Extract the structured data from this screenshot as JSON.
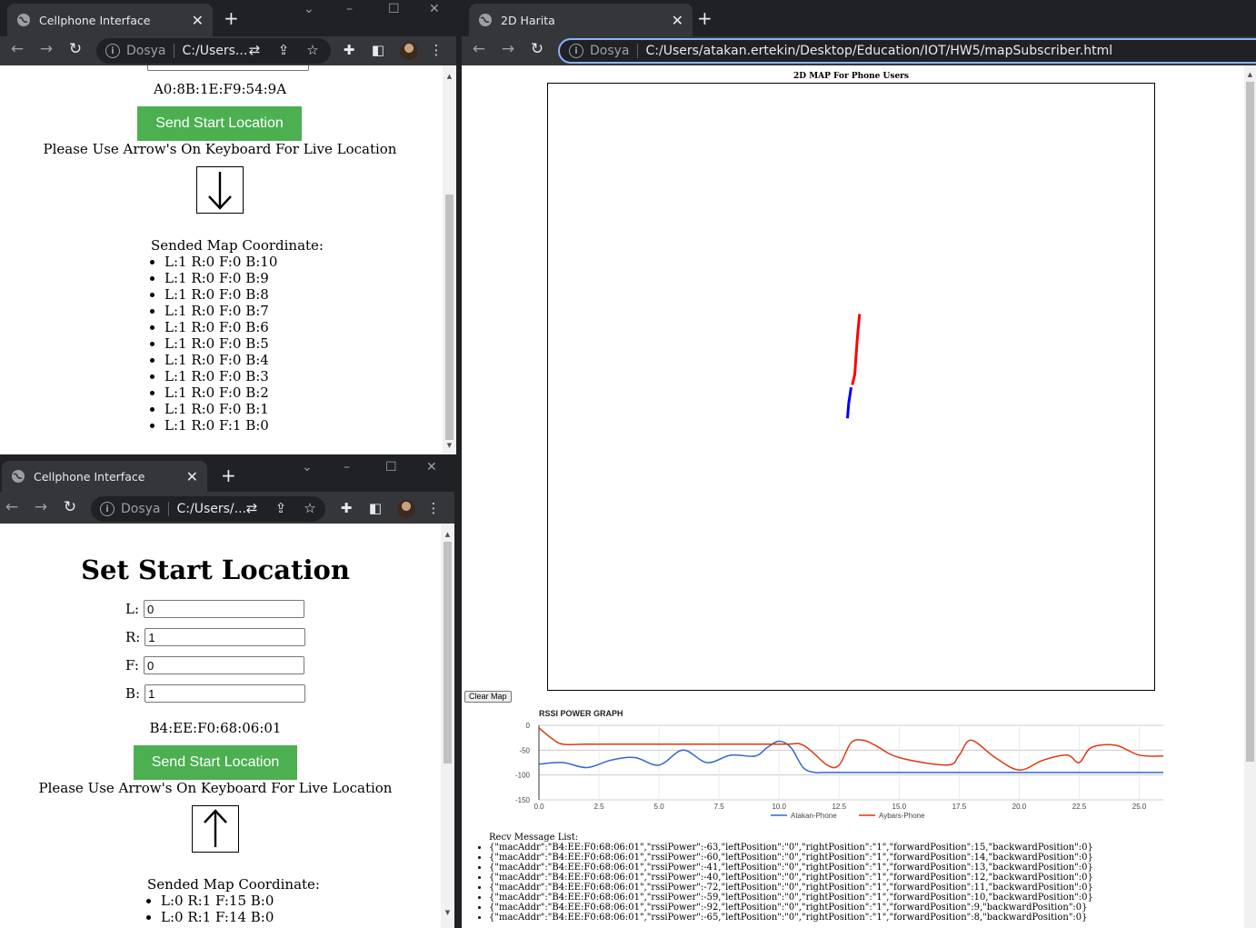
{
  "colors": {
    "accent_green": "#4CAF50",
    "chrome_dark": "#202124",
    "chrome_tab": "#35363a",
    "line_blue": "#0000ff",
    "line_red": "#ff0000",
    "rssi_blue": "#3366cc",
    "rssi_red": "#dc3912"
  },
  "top_left_window": {
    "tab_title": "Cellphone Interface",
    "security_label": "Dosya",
    "url": "C:/Users...",
    "mac": "A0:8B:1E:F9:54:9A",
    "send_button": "Send Start Location",
    "hint": "Please Use Arrow's On Keyboard For Live Location",
    "arrow_icon": "arrow-down-icon",
    "arrow_glyph": "↓",
    "coords_title": "Sended Map Coordinate:",
    "coords": [
      "L:1 R:0 F:0 B:10",
      "L:1 R:0 F:0 B:9",
      "L:1 R:0 F:0 B:8",
      "L:1 R:0 F:0 B:7",
      "L:1 R:0 F:0 B:6",
      "L:1 R:0 F:0 B:5",
      "L:1 R:0 F:0 B:4",
      "L:1 R:0 F:0 B:3",
      "L:1 R:0 F:0 B:2",
      "L:1 R:0 F:0 B:1",
      "L:1 R:0 F:1 B:0"
    ]
  },
  "bottom_left_window": {
    "tab_title": "Cellphone Interface",
    "security_label": "Dosya",
    "url": "C:/Users/...",
    "heading": "Set Start Location",
    "fields": [
      {
        "label": "L:",
        "value": "0"
      },
      {
        "label": "R:",
        "value": "1"
      },
      {
        "label": "F:",
        "value": "0"
      },
      {
        "label": "B:",
        "value": "1"
      }
    ],
    "mac": "B4:EE:F0:68:06:01",
    "send_button": "Send Start Location",
    "hint": "Please Use Arrow's On Keyboard For Live Location",
    "arrow_icon": "arrow-up-icon",
    "arrow_glyph": "↑",
    "coords_title": "Sended Map Coordinate:",
    "coords": [
      "L:0 R:1 F:15 B:0",
      "L:0 R:1 F:14 B:0"
    ]
  },
  "map_window": {
    "tab_title": "2D Harita",
    "security_label": "Dosya",
    "url": "C:/Users/atakan.ertekin/Desktop/Education/IOT/HW5/mapSubscriber.html",
    "map_title": "2D MAP For Phone Users",
    "clear_button": "Clear Map",
    "recv_title": "Recv Message List:",
    "messages": [
      "{\"macAddr\":\"B4:EE:F0:68:06:01\",\"rssiPower\":-63,\"leftPosition\":\"0\",\"rightPosition\":\"1\",\"forwardPosition\":15,\"backwardPosition\":0}",
      "{\"macAddr\":\"B4:EE:F0:68:06:01\",\"rssiPower\":-60,\"leftPosition\":\"0\",\"rightPosition\":\"1\",\"forwardPosition\":14,\"backwardPosition\":0}",
      "{\"macAddr\":\"B4:EE:F0:68:06:01\",\"rssiPower\":-41,\"leftPosition\":\"0\",\"rightPosition\":\"1\",\"forwardPosition\":13,\"backwardPosition\":0}",
      "{\"macAddr\":\"B4:EE:F0:68:06:01\",\"rssiPower\":-40,\"leftPosition\":\"0\",\"rightPosition\":\"1\",\"forwardPosition\":12,\"backwardPosition\":0}",
      "{\"macAddr\":\"B4:EE:F0:68:06:01\",\"rssiPower\":-72,\"leftPosition\":\"0\",\"rightPosition\":\"1\",\"forwardPosition\":11,\"backwardPosition\":0}",
      "{\"macAddr\":\"B4:EE:F0:68:06:01\",\"rssiPower\":-59,\"leftPosition\":\"0\",\"rightPosition\":\"1\",\"forwardPosition\":10,\"backwardPosition\":0}",
      "{\"macAddr\":\"B4:EE:F0:68:06:01\",\"rssiPower\":-92,\"leftPosition\":\"0\",\"rightPosition\":\"1\",\"forwardPosition\":9,\"backwardPosition\":0}",
      "{\"macAddr\":\"B4:EE:F0:68:06:01\",\"rssiPower\":-65,\"leftPosition\":\"0\",\"rightPosition\":\"1\",\"forwardPosition\":8,\"backwardPosition\":0}"
    ]
  },
  "chart_data": {
    "type": "line",
    "title": "RSSI POWER GRAPH",
    "xlabel": "",
    "ylabel": "",
    "xlim": [
      0,
      26
    ],
    "ylim": [
      -150,
      0
    ],
    "xticks": [
      "0.0",
      "2.5",
      "5.0",
      "7.5",
      "10.0",
      "12.5",
      "15.0",
      "17.5",
      "20.0",
      "22.5",
      "25.0"
    ],
    "yticks": [
      "0",
      "-50",
      "-100",
      "-150"
    ],
    "grid": true,
    "legend_position": "bottom",
    "series": [
      {
        "name": "Atakan-Phone",
        "color": "#3366cc",
        "points": [
          [
            0,
            -78
          ],
          [
            1,
            -75
          ],
          [
            2,
            -85
          ],
          [
            3,
            -70
          ],
          [
            4,
            -65
          ],
          [
            5,
            -80
          ],
          [
            6,
            -50
          ],
          [
            7,
            -75
          ],
          [
            8,
            -60
          ],
          [
            9,
            -62
          ],
          [
            9.5,
            -45
          ],
          [
            10,
            -32
          ],
          [
            10.5,
            -45
          ],
          [
            11,
            -85
          ],
          [
            11.5,
            -95
          ],
          [
            12,
            -95
          ],
          [
            15,
            -95
          ],
          [
            20,
            -95
          ],
          [
            26,
            -95
          ]
        ]
      },
      {
        "name": "Aybars-Phone",
        "color": "#dc3912",
        "points": [
          [
            0,
            -5
          ],
          [
            0.5,
            -25
          ],
          [
            1,
            -38
          ],
          [
            2,
            -38
          ],
          [
            5,
            -38
          ],
          [
            10,
            -38
          ],
          [
            11,
            -40
          ],
          [
            12,
            -80
          ],
          [
            12.5,
            -80
          ],
          [
            13,
            -35
          ],
          [
            13.5,
            -30
          ],
          [
            14,
            -40
          ],
          [
            15,
            -65
          ],
          [
            17,
            -80
          ],
          [
            17.5,
            -60
          ],
          [
            18,
            -30
          ],
          [
            19,
            -65
          ],
          [
            20,
            -90
          ],
          [
            21,
            -70
          ],
          [
            22,
            -60
          ],
          [
            22.5,
            -75
          ],
          [
            23,
            -45
          ],
          [
            24,
            -40
          ],
          [
            25,
            -60
          ],
          [
            26,
            -62
          ]
        ]
      }
    ]
  },
  "map_paths": [
    {
      "name": "blue-path",
      "color": "#0000ff",
      "points": [
        [
          0.494,
          0.552
        ],
        [
          0.496,
          0.528
        ],
        [
          0.5,
          0.501
        ]
      ]
    },
    {
      "name": "red-path",
      "color": "#ff0000",
      "points": [
        [
          0.502,
          0.497
        ],
        [
          0.506,
          0.48
        ],
        [
          0.51,
          0.422
        ],
        [
          0.514,
          0.38
        ]
      ]
    }
  ]
}
